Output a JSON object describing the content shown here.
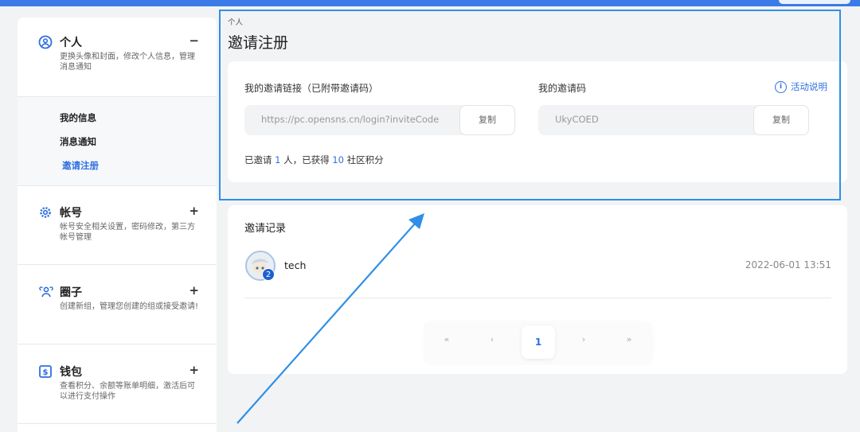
{
  "sidebar": {
    "personal": {
      "icon": "user-circle-icon",
      "title": "个人",
      "toggle": "−",
      "desc": "更换头像和封面，修改个人信息，管理消息通知"
    },
    "subnav": [
      {
        "label": "我的信息"
      },
      {
        "label": "消息通知"
      },
      {
        "label": "邀请注册"
      }
    ],
    "account": {
      "icon": "gear-icon",
      "title": "帐号",
      "toggle": "+",
      "desc": "帐号安全相关设置，密码修改，第三方帐号管理"
    },
    "circle": {
      "icon": "group-icon",
      "title": "圈子",
      "toggle": "+",
      "desc": "创建新组，管理您创建的组或接受邀请!"
    },
    "wallet": {
      "icon": "wallet-icon",
      "title": "钱包",
      "toggle": "+",
      "desc": "查看积分、余额等账单明细，激活后可以进行支付操作"
    }
  },
  "main": {
    "breadcrumb": "个人",
    "title": "邀请注册",
    "invite_link_label": "我的邀请链接（已附带邀请码）",
    "invite_link_value": "https://pc.opensns.cn/login?inviteCode",
    "copy_label": "复制",
    "invite_code_label": "我的邀请码",
    "invite_code_value": "UkyCOED",
    "help_label": "活动说明",
    "stat_prefix": "已邀请",
    "stat_invited": "1",
    "stat_mid": "人，已获得",
    "stat_points": "10",
    "stat_suffix": "社区积分"
  },
  "records": {
    "title": "邀请记录",
    "items": [
      {
        "name": "tech",
        "badge": "2",
        "time": "2022-06-01 13:51"
      }
    ]
  },
  "pagination": {
    "first": "«",
    "prev": "‹",
    "current": "1",
    "next": "›",
    "last": "»"
  },
  "colors": {
    "accent": "#2f6fe0",
    "annotation": "#2f8fe6"
  }
}
